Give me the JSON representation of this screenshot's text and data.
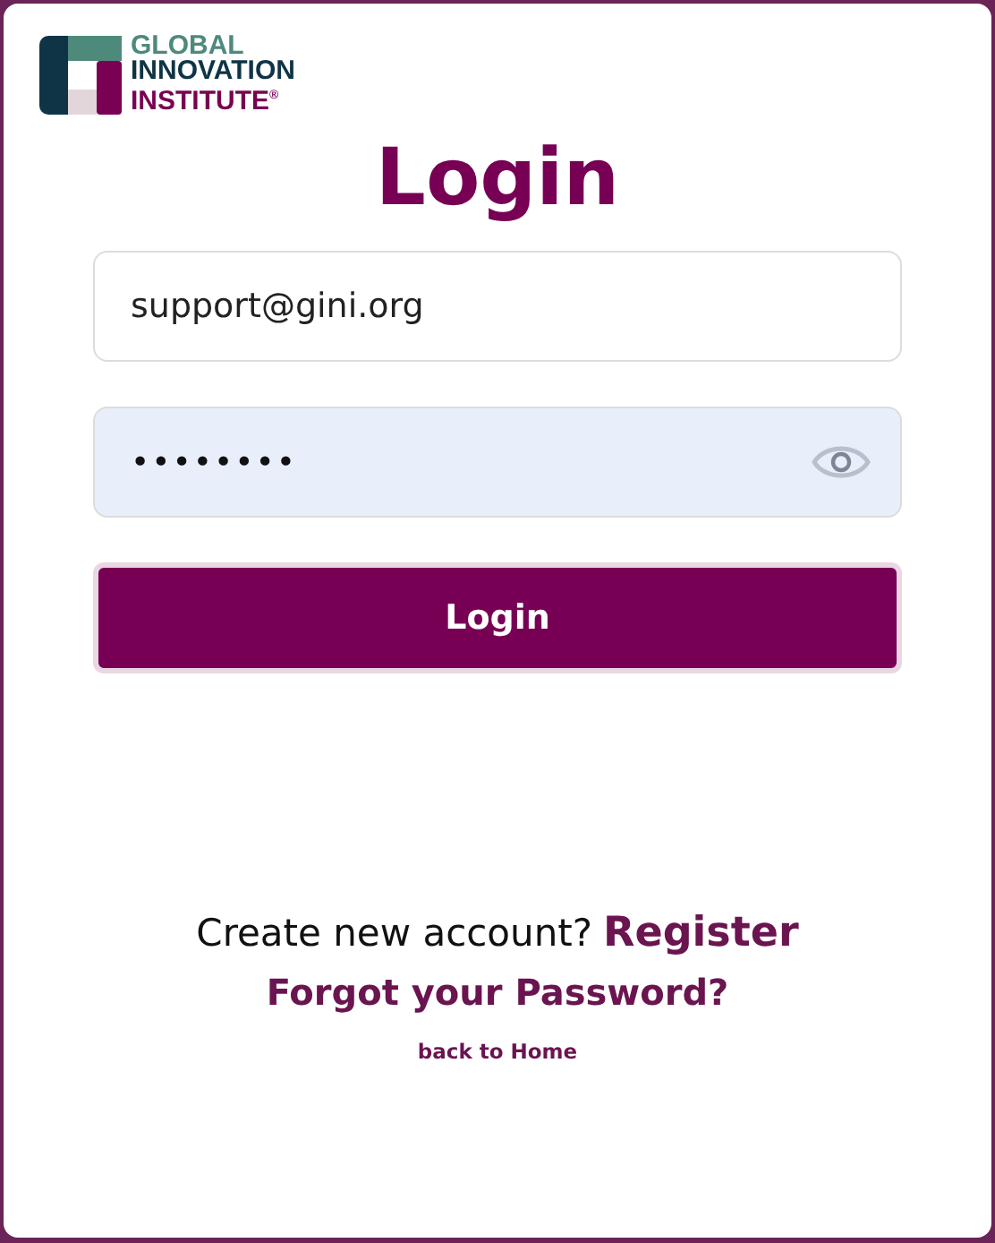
{
  "logo": {
    "lines": [
      "GLOBAL",
      "INNOVATION",
      "INSTITUTE$^{®}$"
    ]
  },
  "title": "Login",
  "email": {
    "value": "support@gini.org"
  },
  "password": {
    "value": "••••••••"
  },
  "login_button": "Login",
  "register_prompt": {
    "text": "Create new account?",
    "link": "Register"
  },
  "forgot_link": "Forgot your Password?",
  "home_link": "back to Home"
}
